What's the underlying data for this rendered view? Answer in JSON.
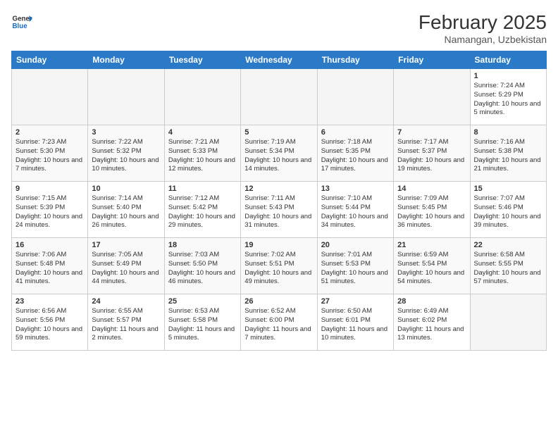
{
  "header": {
    "logo_line1": "General",
    "logo_line2": "Blue",
    "month_year": "February 2025",
    "location": "Namangan, Uzbekistan"
  },
  "weekdays": [
    "Sunday",
    "Monday",
    "Tuesday",
    "Wednesday",
    "Thursday",
    "Friday",
    "Saturday"
  ],
  "weeks": [
    [
      {
        "day": "",
        "info": ""
      },
      {
        "day": "",
        "info": ""
      },
      {
        "day": "",
        "info": ""
      },
      {
        "day": "",
        "info": ""
      },
      {
        "day": "",
        "info": ""
      },
      {
        "day": "",
        "info": ""
      },
      {
        "day": "1",
        "info": "Sunrise: 7:24 AM\nSunset: 5:29 PM\nDaylight: 10 hours and 5 minutes."
      }
    ],
    [
      {
        "day": "2",
        "info": "Sunrise: 7:23 AM\nSunset: 5:30 PM\nDaylight: 10 hours and 7 minutes."
      },
      {
        "day": "3",
        "info": "Sunrise: 7:22 AM\nSunset: 5:32 PM\nDaylight: 10 hours and 10 minutes."
      },
      {
        "day": "4",
        "info": "Sunrise: 7:21 AM\nSunset: 5:33 PM\nDaylight: 10 hours and 12 minutes."
      },
      {
        "day": "5",
        "info": "Sunrise: 7:19 AM\nSunset: 5:34 PM\nDaylight: 10 hours and 14 minutes."
      },
      {
        "day": "6",
        "info": "Sunrise: 7:18 AM\nSunset: 5:35 PM\nDaylight: 10 hours and 17 minutes."
      },
      {
        "day": "7",
        "info": "Sunrise: 7:17 AM\nSunset: 5:37 PM\nDaylight: 10 hours and 19 minutes."
      },
      {
        "day": "8",
        "info": "Sunrise: 7:16 AM\nSunset: 5:38 PM\nDaylight: 10 hours and 21 minutes."
      }
    ],
    [
      {
        "day": "9",
        "info": "Sunrise: 7:15 AM\nSunset: 5:39 PM\nDaylight: 10 hours and 24 minutes."
      },
      {
        "day": "10",
        "info": "Sunrise: 7:14 AM\nSunset: 5:40 PM\nDaylight: 10 hours and 26 minutes."
      },
      {
        "day": "11",
        "info": "Sunrise: 7:12 AM\nSunset: 5:42 PM\nDaylight: 10 hours and 29 minutes."
      },
      {
        "day": "12",
        "info": "Sunrise: 7:11 AM\nSunset: 5:43 PM\nDaylight: 10 hours and 31 minutes."
      },
      {
        "day": "13",
        "info": "Sunrise: 7:10 AM\nSunset: 5:44 PM\nDaylight: 10 hours and 34 minutes."
      },
      {
        "day": "14",
        "info": "Sunrise: 7:09 AM\nSunset: 5:45 PM\nDaylight: 10 hours and 36 minutes."
      },
      {
        "day": "15",
        "info": "Sunrise: 7:07 AM\nSunset: 5:46 PM\nDaylight: 10 hours and 39 minutes."
      }
    ],
    [
      {
        "day": "16",
        "info": "Sunrise: 7:06 AM\nSunset: 5:48 PM\nDaylight: 10 hours and 41 minutes."
      },
      {
        "day": "17",
        "info": "Sunrise: 7:05 AM\nSunset: 5:49 PM\nDaylight: 10 hours and 44 minutes."
      },
      {
        "day": "18",
        "info": "Sunrise: 7:03 AM\nSunset: 5:50 PM\nDaylight: 10 hours and 46 minutes."
      },
      {
        "day": "19",
        "info": "Sunrise: 7:02 AM\nSunset: 5:51 PM\nDaylight: 10 hours and 49 minutes."
      },
      {
        "day": "20",
        "info": "Sunrise: 7:01 AM\nSunset: 5:53 PM\nDaylight: 10 hours and 51 minutes."
      },
      {
        "day": "21",
        "info": "Sunrise: 6:59 AM\nSunset: 5:54 PM\nDaylight: 10 hours and 54 minutes."
      },
      {
        "day": "22",
        "info": "Sunrise: 6:58 AM\nSunset: 5:55 PM\nDaylight: 10 hours and 57 minutes."
      }
    ],
    [
      {
        "day": "23",
        "info": "Sunrise: 6:56 AM\nSunset: 5:56 PM\nDaylight: 10 hours and 59 minutes."
      },
      {
        "day": "24",
        "info": "Sunrise: 6:55 AM\nSunset: 5:57 PM\nDaylight: 11 hours and 2 minutes."
      },
      {
        "day": "25",
        "info": "Sunrise: 6:53 AM\nSunset: 5:58 PM\nDaylight: 11 hours and 5 minutes."
      },
      {
        "day": "26",
        "info": "Sunrise: 6:52 AM\nSunset: 6:00 PM\nDaylight: 11 hours and 7 minutes."
      },
      {
        "day": "27",
        "info": "Sunrise: 6:50 AM\nSunset: 6:01 PM\nDaylight: 11 hours and 10 minutes."
      },
      {
        "day": "28",
        "info": "Sunrise: 6:49 AM\nSunset: 6:02 PM\nDaylight: 11 hours and 13 minutes."
      },
      {
        "day": "",
        "info": ""
      }
    ]
  ]
}
